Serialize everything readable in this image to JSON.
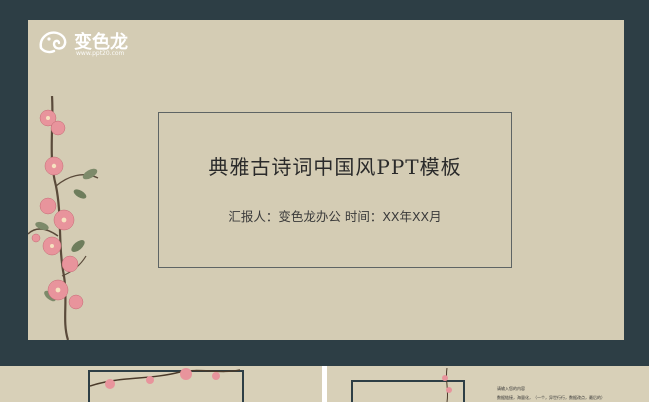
{
  "logo": {
    "name": "变色龙",
    "url": "www.ppt20.com"
  },
  "slide": {
    "title": "典雅古诗词中国风PPT模板",
    "subtitle": "汇报人：变色龙办公   时间：XX年XX月"
  },
  "thumbnails": {
    "second_lines": [
      "请输入您的内容",
      "数据链接，海量化，（一个，异世行行，数据改点，最后的）"
    ]
  },
  "colors": {
    "frame": "#2d3e45",
    "background": "#d4ccb4",
    "accent_flower": "#e58a94"
  }
}
